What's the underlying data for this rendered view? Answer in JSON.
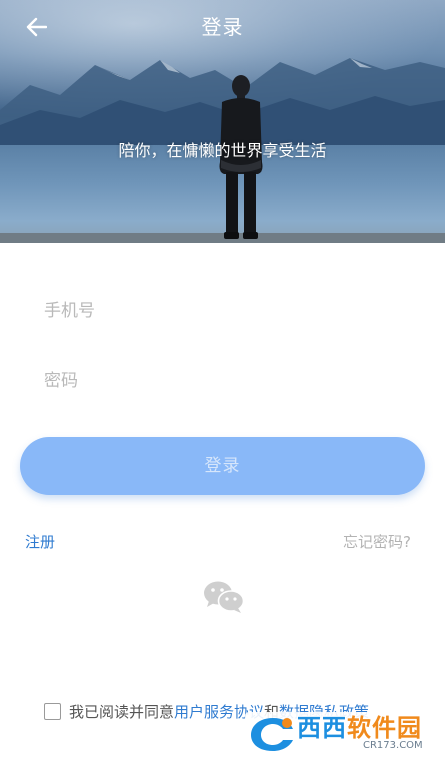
{
  "header": {
    "title": "登录",
    "back_icon": "arrow-left-icon"
  },
  "hero": {
    "slogan": "陪你，在慵懒的世界享受生活"
  },
  "form": {
    "phone_placeholder": "手机号",
    "password_placeholder": "密码",
    "login_label": "登录"
  },
  "links": {
    "register": "注册",
    "forgot_password": "忘记密码?"
  },
  "social": {
    "wechat_icon": "wechat-icon"
  },
  "agreement": {
    "prefix": "我已阅读并同意",
    "user_agreement": "用户服务协议",
    "conjunction": "和",
    "privacy_policy": "数据隐私政策"
  },
  "watermark": {
    "brand_part1": "西西",
    "brand_part2": "软件园",
    "url": "CR173.COM"
  },
  "colors": {
    "accent": "#2f7bd0",
    "login_button": "#89b8f8",
    "placeholder": "#b9b9b9"
  }
}
